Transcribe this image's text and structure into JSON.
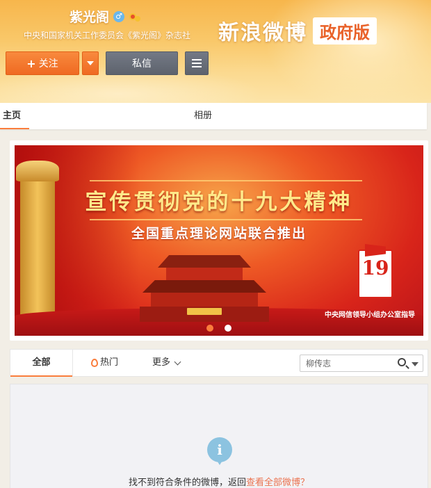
{
  "profile": {
    "name": "紫光阁",
    "gender_icon": "male-icon",
    "gender_symbol": "♂",
    "badge_icon": "verified-badge-icon",
    "subtitle": "中央和国家机关工作委员会《紫光阁》杂志社"
  },
  "logo": {
    "text": "新浪微博",
    "tag": "政府版"
  },
  "actions": {
    "follow_plus": "+",
    "follow_label": "关注",
    "message_label": "私信"
  },
  "nav": {
    "tabs": [
      {
        "label": "主页",
        "active": true
      },
      {
        "label": "相册",
        "active": false
      }
    ]
  },
  "banner": {
    "title": "宣传贯彻党的十九大精神",
    "subtitle": "全国重点理论网站联合推出",
    "emblem_number": "19",
    "credit": "中央网信领导小组办公室指导",
    "slides": 2,
    "active_slide": 1
  },
  "filter": {
    "tab_all": "全部",
    "tab_hot": "热门",
    "tab_more": "更多",
    "search_placeholder": "柳传志"
  },
  "empty": {
    "icon": "info-icon",
    "icon_glyph": "i",
    "message": "找不到符合条件的微博，返回",
    "link": "查看全部微博？"
  },
  "colors": {
    "accent": "#fa7d3c",
    "link": "#eb7350",
    "follow_button": "#ef6a22",
    "message_button": "#5e636d",
    "info": "#8cc3e0"
  }
}
